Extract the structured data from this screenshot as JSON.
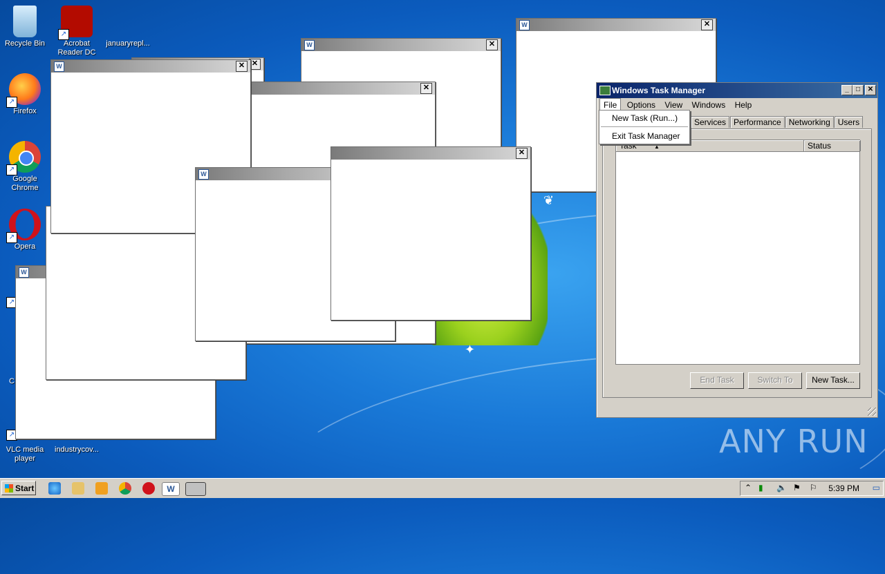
{
  "desktop": {
    "icons": [
      {
        "label": "Recycle Bin"
      },
      {
        "label": "Acrobat Reader DC"
      },
      {
        "label": "januaryrepl..."
      },
      {
        "label": "Firefox"
      },
      {
        "label": "Google Chrome"
      },
      {
        "label": "Opera"
      },
      {
        "label": "VLC media player"
      },
      {
        "label": "industrycov..."
      }
    ],
    "partial_labels": [
      "C"
    ],
    "watermark": "ANY RUN"
  },
  "task_manager": {
    "title": "Windows Task Manager",
    "menu": [
      "File",
      "Options",
      "View",
      "Windows",
      "Help"
    ],
    "file_menu": [
      "New Task (Run...)",
      "Exit Task Manager"
    ],
    "tabs": [
      "Services",
      "Performance",
      "Networking",
      "Users"
    ],
    "columns": [
      "Task",
      "Status"
    ],
    "buttons": {
      "end_task": "End Task",
      "switch_to": "Switch To",
      "new_task": "New Task..."
    }
  },
  "taskbar": {
    "start_label": "Start",
    "clock": "5:39 PM"
  },
  "colors": {
    "titlebar_active": "#0a246a",
    "desktop_blue": "#1a7ad8",
    "classic_face": "#d4d0c8"
  }
}
